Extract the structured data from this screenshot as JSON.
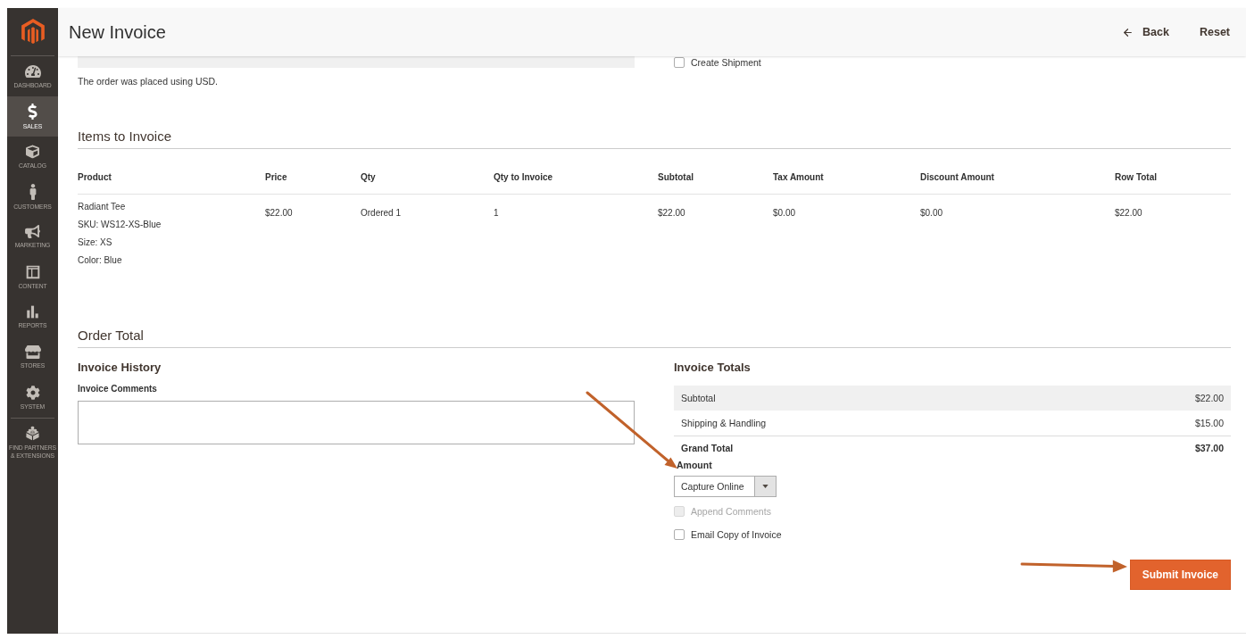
{
  "sidebar": {
    "items": [
      {
        "label": "DASHBOARD",
        "selected": false
      },
      {
        "label": "SALES",
        "selected": true
      },
      {
        "label": "CATALOG",
        "selected": false
      },
      {
        "label": "CUSTOMERS",
        "selected": false
      },
      {
        "label": "MARKETING",
        "selected": false
      },
      {
        "label": "CONTENT",
        "selected": false
      },
      {
        "label": "REPORTS",
        "selected": false
      },
      {
        "label": "STORES",
        "selected": false
      },
      {
        "label": "SYSTEM",
        "selected": false
      },
      {
        "label": "FIND PARTNERS & EXTENSIONS",
        "selected": false
      }
    ]
  },
  "header": {
    "title": "New Invoice",
    "actions": [
      {
        "label": "Back",
        "kind": "back"
      },
      {
        "label": "Reset",
        "kind": "plain"
      }
    ]
  },
  "order_info": {
    "note": "The order was placed using USD."
  },
  "shipment": {
    "label": "Create Shipment",
    "checked": false
  },
  "items_to_invoice": {
    "title": "Items to Invoice",
    "columns": [
      "Product",
      "Price",
      "Qty",
      "Qty to Invoice",
      "Subtotal",
      "Tax Amount",
      "Discount Amount",
      "Row Total"
    ],
    "rows": [
      {
        "cells": [
          "Radiant Tee",
          "$22.00",
          "Ordered 1",
          "1",
          "$22.00",
          "$0.00",
          "$0.00",
          "$22.00"
        ],
        "product_options": [
          "SKU: WS12-XS-Blue",
          "Size: XS",
          "Color: Blue"
        ]
      }
    ]
  },
  "order_total": {
    "title": "Order Total",
    "invoice_history": {
      "title": "Invoice History",
      "comments_label": "Invoice Comments"
    },
    "invoice_totals": {
      "title": "Invoice Totals",
      "rows": [
        {
          "kind": "shaded",
          "label": "Subtotal",
          "value": "$22.00"
        },
        {
          "kind": "plain",
          "label": "Shipping & Handling",
          "value": "$15.00"
        },
        {
          "kind": "grand",
          "label": "Grand Total",
          "value": "$37.00"
        }
      ],
      "amount": {
        "label": "Amount",
        "value": "Capture Online"
      },
      "options": [
        {
          "label": "Append Comments",
          "checked": false,
          "disabled": true
        },
        {
          "label": "Email Copy of Invoice",
          "checked": false,
          "disabled": false
        }
      ],
      "submit": "Submit Invoice"
    }
  }
}
